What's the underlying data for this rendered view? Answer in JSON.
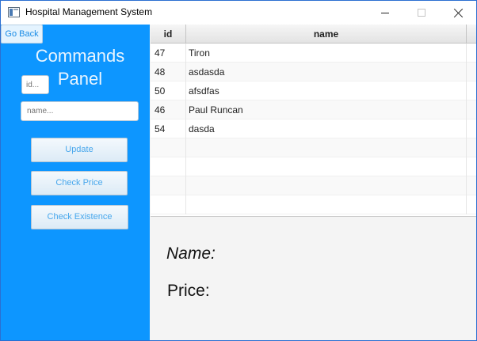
{
  "window": {
    "title": "Hospital Management System",
    "controls": [
      "minimize",
      "maximize",
      "close"
    ]
  },
  "left_panel": {
    "background_color": "#0d96ff",
    "go_back_label": "Go Back",
    "title_line1": "Commands",
    "title_line2": "Panel",
    "id_placeholder": "id...",
    "name_placeholder": "name...",
    "buttons": {
      "update": "Update",
      "check_price": "Check Price",
      "check_existence": "Check Existence"
    }
  },
  "table": {
    "columns": [
      "id",
      "name"
    ],
    "rows": [
      {
        "id": "47",
        "name": "Tiron"
      },
      {
        "id": "48",
        "name": "asdasda"
      },
      {
        "id": "50",
        "name": "afsdfas"
      },
      {
        "id": "46",
        "name": "Paul Runcan"
      },
      {
        "id": "54",
        "name": "dasda"
      }
    ],
    "empty_rows": 4
  },
  "details": {
    "name_label": "Name:",
    "price_label": "Price:"
  }
}
